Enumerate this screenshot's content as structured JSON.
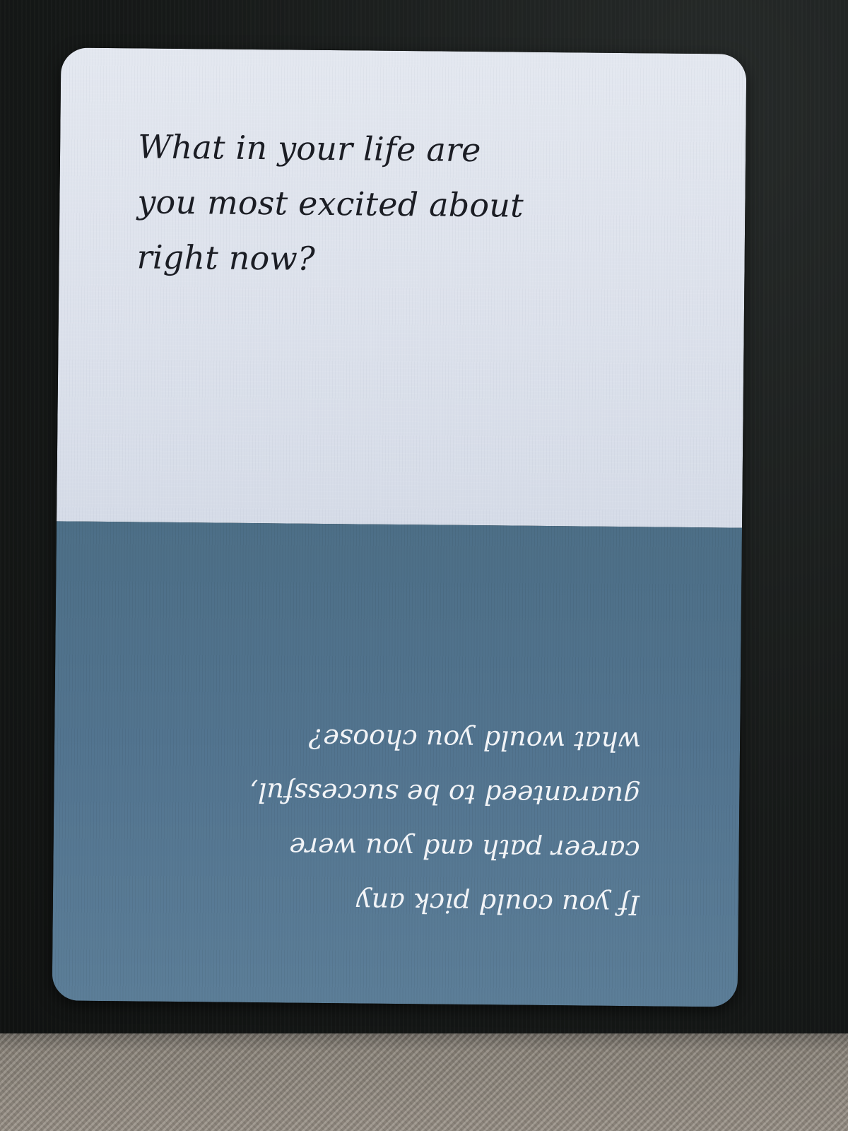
{
  "scene": {
    "description_free": true
  },
  "card": {
    "top_question": {
      "lines": [
        "What in your life are",
        "you most excited about",
        "right now?"
      ]
    },
    "bottom_question": {
      "lines": [
        "If you could pick any",
        "career path and you were",
        "guaranteed to be successful,",
        "what would you choose?"
      ]
    },
    "colors": {
      "top_half": "#dde2ec",
      "bottom_half": "#537590",
      "top_text": "#1b1d24",
      "bottom_text": "#f2f4f7"
    }
  }
}
